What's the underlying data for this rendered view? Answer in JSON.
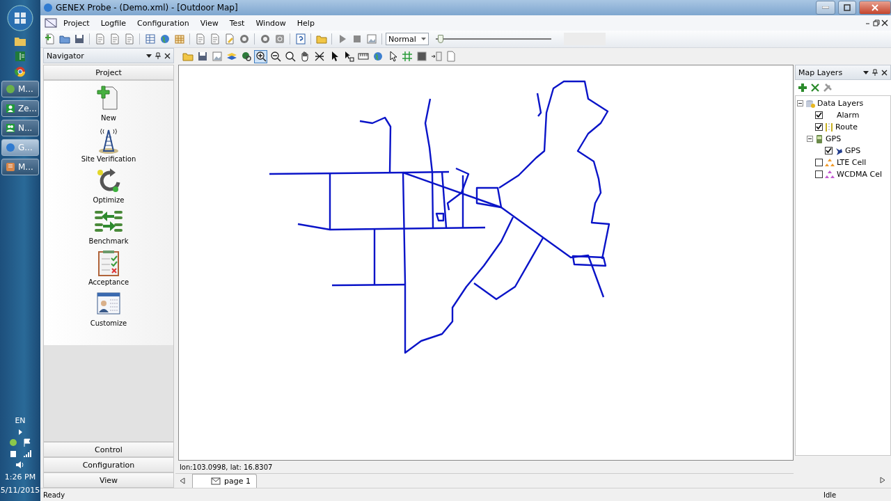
{
  "window": {
    "title": "GENEX Probe - (Demo.xml) - [Outdoor Map]"
  },
  "menu": [
    "Project",
    "Logfile",
    "Configuration",
    "View",
    "Test",
    "Window",
    "Help"
  ],
  "toolbar": {
    "speed": "Normal",
    "playback": {
      "level": 0.02
    }
  },
  "map_tools": [
    {
      "selected": false
    },
    {
      "selected": false
    },
    {
      "selected": false
    },
    {
      "selected": false
    },
    {
      "selected": false
    },
    {
      "selected": true
    },
    {
      "selected": false
    },
    {
      "selected": false
    },
    {
      "selected": false
    },
    {
      "selected": false
    },
    {
      "selected": false
    },
    {
      "selected": false
    },
    {
      "selected": false
    },
    {
      "selected": false
    },
    {
      "selected": false
    },
    {
      "selected": false
    },
    {
      "selected": false
    },
    {
      "selected": false
    },
    {
      "selected": false
    }
  ],
  "navigator": {
    "title": "Navigator",
    "section": "Project",
    "items": [
      {
        "label": "New",
        "kind": "new"
      },
      {
        "label": "Site Verification",
        "kind": "tower"
      },
      {
        "label": "Optimize",
        "kind": "optimize"
      },
      {
        "label": "Benchmark",
        "kind": "benchmark"
      },
      {
        "label": "Acceptance",
        "kind": "acceptance"
      },
      {
        "label": "Customize",
        "kind": "customize"
      }
    ],
    "bottom_sections": [
      "Control",
      "Configuration",
      "View"
    ]
  },
  "map": {
    "coordinates": "lon:103.0998, lat: 16.8307",
    "tabs": [
      {
        "label": "page 1",
        "selected": true
      }
    ]
  },
  "map_layers": {
    "title": "Map Layers",
    "tree": [
      {
        "label": "Data Layers",
        "kind": "database",
        "expanded": true,
        "children": [
          {
            "label": "Alarm",
            "kind": "alarm",
            "checked": true
          },
          {
            "label": "Route",
            "kind": "route",
            "checked": true
          },
          {
            "label": "GPS",
            "kind": "device",
            "expanded": true,
            "children": [
              {
                "label": "GPS",
                "kind": "pin",
                "checked": true
              }
            ]
          },
          {
            "label": "LTE Cell",
            "kind": "lte",
            "checked": false
          },
          {
            "label": "WCDMA Cel",
            "kind": "wcdma",
            "checked": false
          }
        ]
      }
    ]
  },
  "status_bar": {
    "left": "Ready",
    "right": "Idle"
  },
  "taskbar": {
    "tasks": [
      {
        "label": "M...",
        "kind": "green",
        "selected": false
      },
      {
        "label": "Ze...",
        "kind": "person",
        "selected": false
      },
      {
        "label": "N...",
        "kind": "people",
        "selected": false
      },
      {
        "label": "G...",
        "kind": "probe",
        "selected": true
      },
      {
        "label": "M...",
        "kind": "book",
        "selected": false
      }
    ],
    "language": "EN",
    "time": "1:26 PM",
    "date": "5/11/2015"
  }
}
